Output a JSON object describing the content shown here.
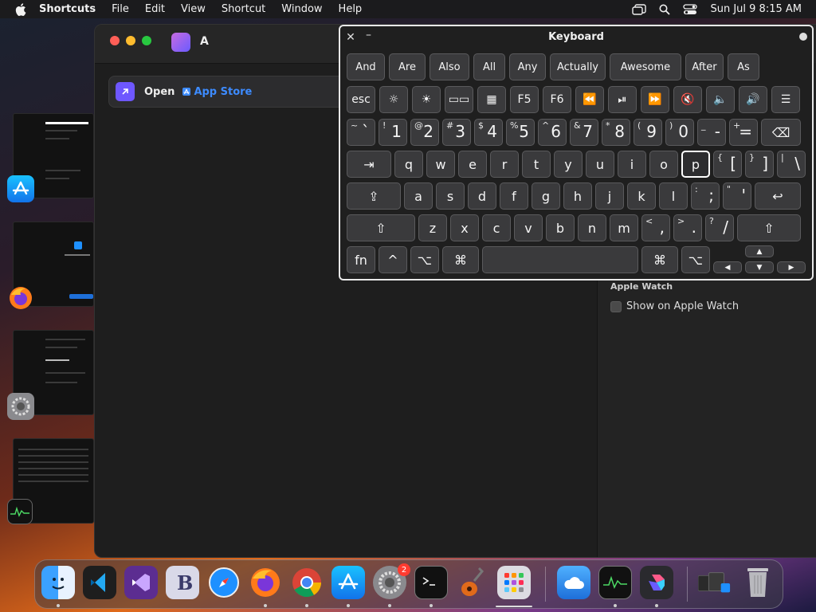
{
  "menubar": {
    "app": "Shortcuts",
    "items": [
      "File",
      "Edit",
      "View",
      "Shortcut",
      "Window",
      "Help"
    ],
    "clock": "Sun Jul 9  8:15 AM"
  },
  "shortcuts_window": {
    "title": "A",
    "action_open": "Open",
    "action_target": "App Store",
    "apple_watch_label": "Apple Watch",
    "apple_watch_option": "Show on Apple Watch"
  },
  "keyboard": {
    "title": "Keyboard",
    "close_glyph": "✕",
    "min_glyph": "–",
    "suggestions": [
      "And",
      "Are",
      "Also",
      "All",
      "Any",
      "Actually",
      "Awesome",
      "After",
      "As"
    ],
    "fn_row": [
      "esc",
      "☼",
      "☀",
      "▭▭",
      "▦",
      "F5",
      "F6",
      "⏪",
      "⏯",
      "⏩",
      "🔇",
      "🔈",
      "🔊",
      "☰"
    ],
    "num_row": [
      {
        "sh": "~",
        "mn": "`"
      },
      {
        "sh": "!",
        "mn": "1"
      },
      {
        "sh": "@",
        "mn": "2"
      },
      {
        "sh": "#",
        "mn": "3"
      },
      {
        "sh": "$",
        "mn": "4"
      },
      {
        "sh": "%",
        "mn": "5"
      },
      {
        "sh": "^",
        "mn": "6"
      },
      {
        "sh": "&",
        "mn": "7"
      },
      {
        "sh": "*",
        "mn": "8"
      },
      {
        "sh": "(",
        "mn": "9"
      },
      {
        "sh": ")",
        "mn": "0"
      },
      {
        "sh": "_",
        "mn": "-"
      },
      {
        "sh": "+",
        "mn": "="
      }
    ],
    "delete": "⌫",
    "tab": "⇥",
    "q_row": [
      "q",
      "w",
      "e",
      "r",
      "t",
      "y",
      "u",
      "i",
      "o",
      "p"
    ],
    "q_row_sym": [
      {
        "sh": "{",
        "mn": "["
      },
      {
        "sh": "}",
        "mn": "]"
      },
      {
        "sh": "|",
        "mn": "\\"
      }
    ],
    "caps": "⇪",
    "a_row": [
      "a",
      "s",
      "d",
      "f",
      "g",
      "h",
      "j",
      "k",
      "l"
    ],
    "a_row_sym": [
      {
        "sh": ":",
        "mn": ";"
      },
      {
        "sh": "\"",
        "mn": "'"
      }
    ],
    "return": "↩",
    "shift": "⇧",
    "z_row": [
      "z",
      "x",
      "c",
      "v",
      "b",
      "n",
      "m"
    ],
    "z_row_sym": [
      {
        "sh": "<",
        "mn": ","
      },
      {
        "sh": ">",
        "mn": "."
      },
      {
        "sh": "?",
        "mn": "/"
      }
    ],
    "bottom": {
      "fn": "fn",
      "ctrl": "^",
      "opt": "⌥",
      "cmd": "⌘",
      "cmd_r": "⌘",
      "opt_r": "⌥"
    },
    "arrows": {
      "up": "▲",
      "left": "◀",
      "down": "▼",
      "right": "▶"
    },
    "pressed_key": "p"
  },
  "dock": {
    "badge_count": "2"
  },
  "colors": {
    "accent": "#3d8bff",
    "close": "#ff5f57",
    "minimize": "#febc2e",
    "zoom": "#28c840"
  }
}
